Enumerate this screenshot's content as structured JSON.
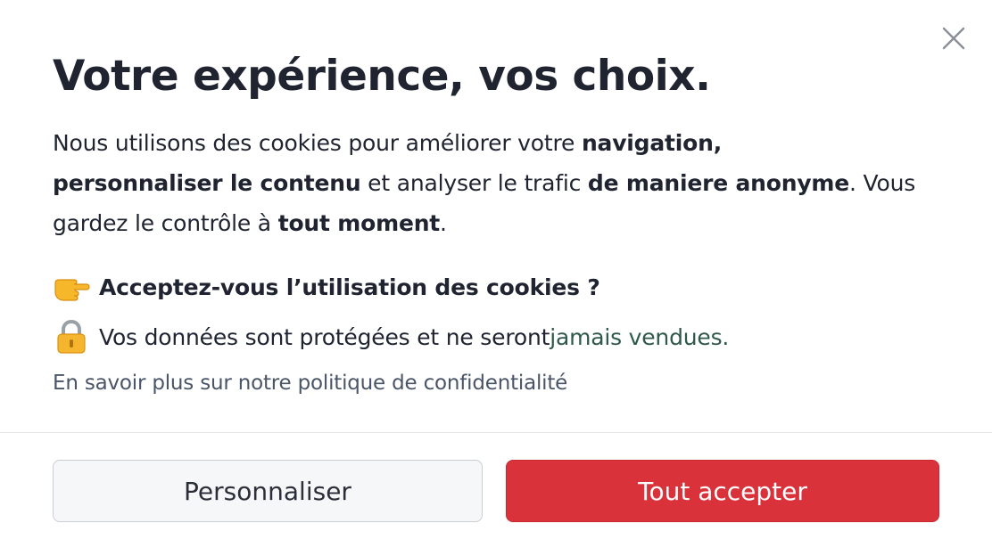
{
  "dialog": {
    "close_icon": "close-icon",
    "title": "Votre expérience, vos choix.",
    "description": {
      "p1": "Nous utilisons des cookies pour améliorer votre ",
      "b1": "navigation,",
      "p2": " ",
      "b2": "personnaliser le contenu",
      "p3": " et analyser le trafic ",
      "b3": "de maniere anonyme",
      "p4": ". Vous gardez le contrôle à ",
      "b4": "tout moment",
      "p5": "."
    },
    "question": {
      "icon": "pointing-hand-icon",
      "text": "Acceptez-vous l’utilisation des cookies ?"
    },
    "protection": {
      "icon": "lock-icon",
      "text": "Vos données sont protégées et ne seront ",
      "accent": "jamais vendues."
    },
    "privacy_link": "En savoir plus sur notre politique de confidentialité",
    "buttons": {
      "customize": "Personnaliser",
      "accept_all": "Tout accepter"
    },
    "colors": {
      "primary": "#d9323a",
      "text": "#1f2430",
      "link": "#4a5568",
      "accent": "#2f5a4a"
    }
  }
}
